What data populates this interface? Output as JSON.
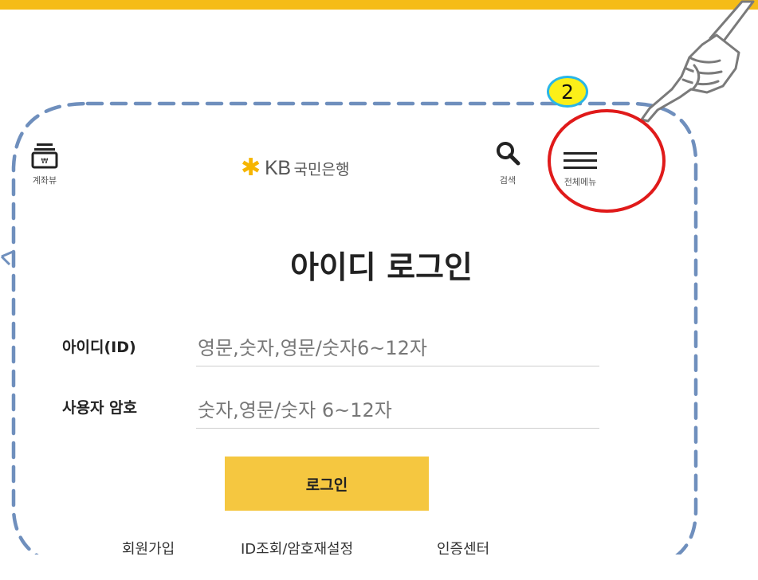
{
  "annotation": {
    "step_number": "2"
  },
  "header": {
    "account_view_label": "계좌뷰",
    "logo_brand": "KB",
    "logo_bank_name": "국민은행",
    "search_label": "검색",
    "full_menu_label": "전체메뉴"
  },
  "main": {
    "title": "아이디 로그인",
    "id_field": {
      "label": "아이디(ID)",
      "placeholder": "영문,숫자,영문/숫자6~12자",
      "value": ""
    },
    "password_field": {
      "label": "사용자 암호",
      "placeholder": "숫자,영문/숫자 6~12자",
      "value": ""
    },
    "login_button_label": "로그인"
  },
  "footer_links": {
    "join": "회원가입",
    "find_id_reset_pw": "ID조회/암호재설정",
    "cert_center": "인증센터"
  },
  "colors": {
    "top_bar": "#f5bc17",
    "login_button": "#f5c740",
    "dashed_frame": "#6f8fbd",
    "highlight_circle": "#e01a1a",
    "badge_fill": "#fbef19",
    "badge_border": "#29b6e8",
    "logo_star": "#f6b500"
  },
  "icons": {
    "account_view": "wallet-stack-icon",
    "search": "magnifier-icon",
    "full_menu": "hamburger-menu-icon",
    "pointer": "pointing-hand-icon"
  }
}
